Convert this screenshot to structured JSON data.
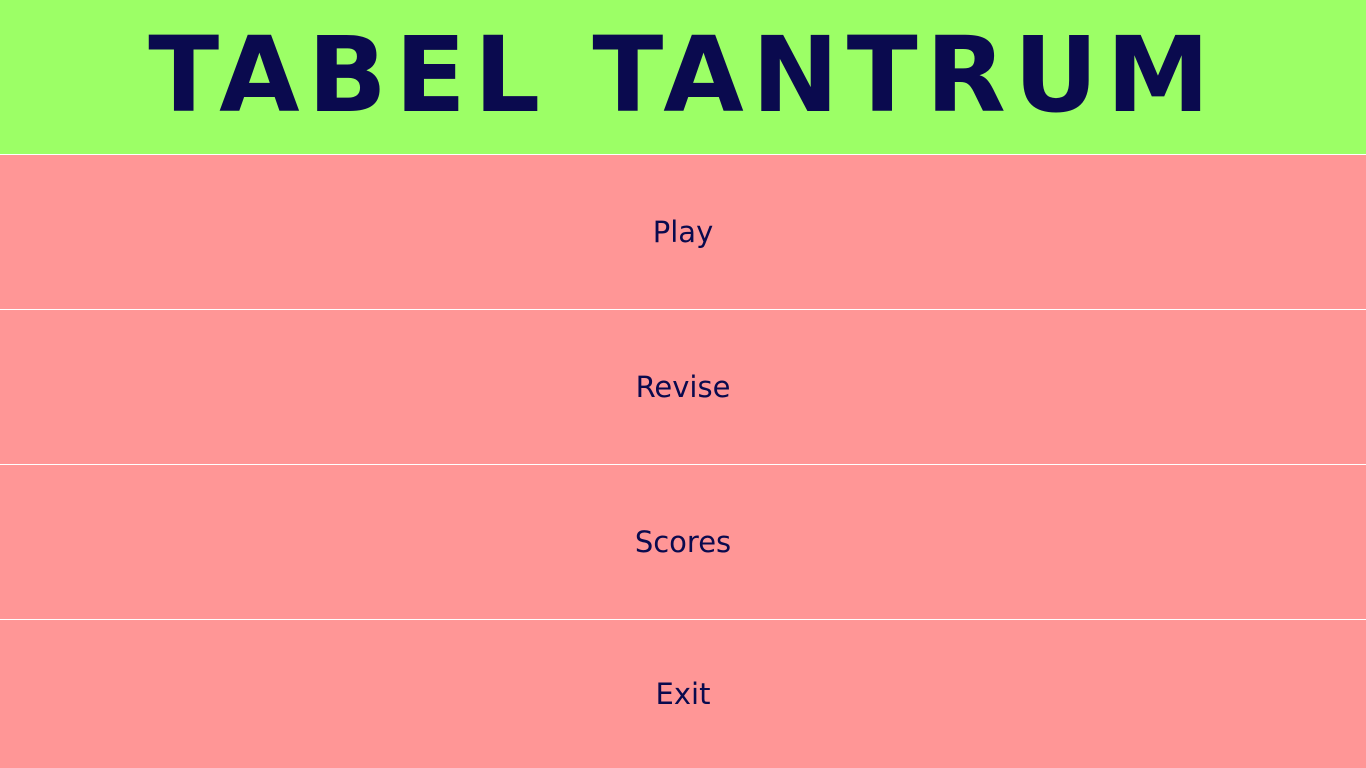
{
  "app": {
    "title": "TABEL TANTRUM"
  },
  "menu": {
    "items": [
      {
        "label": "Play"
      },
      {
        "label": "Revise"
      },
      {
        "label": "Scores"
      },
      {
        "label": "Exit"
      }
    ]
  },
  "colors": {
    "header_bg": "#9cff66",
    "menu_bg": "#ff9696",
    "text": "#0a0a4e",
    "divider": "#ffffff"
  }
}
